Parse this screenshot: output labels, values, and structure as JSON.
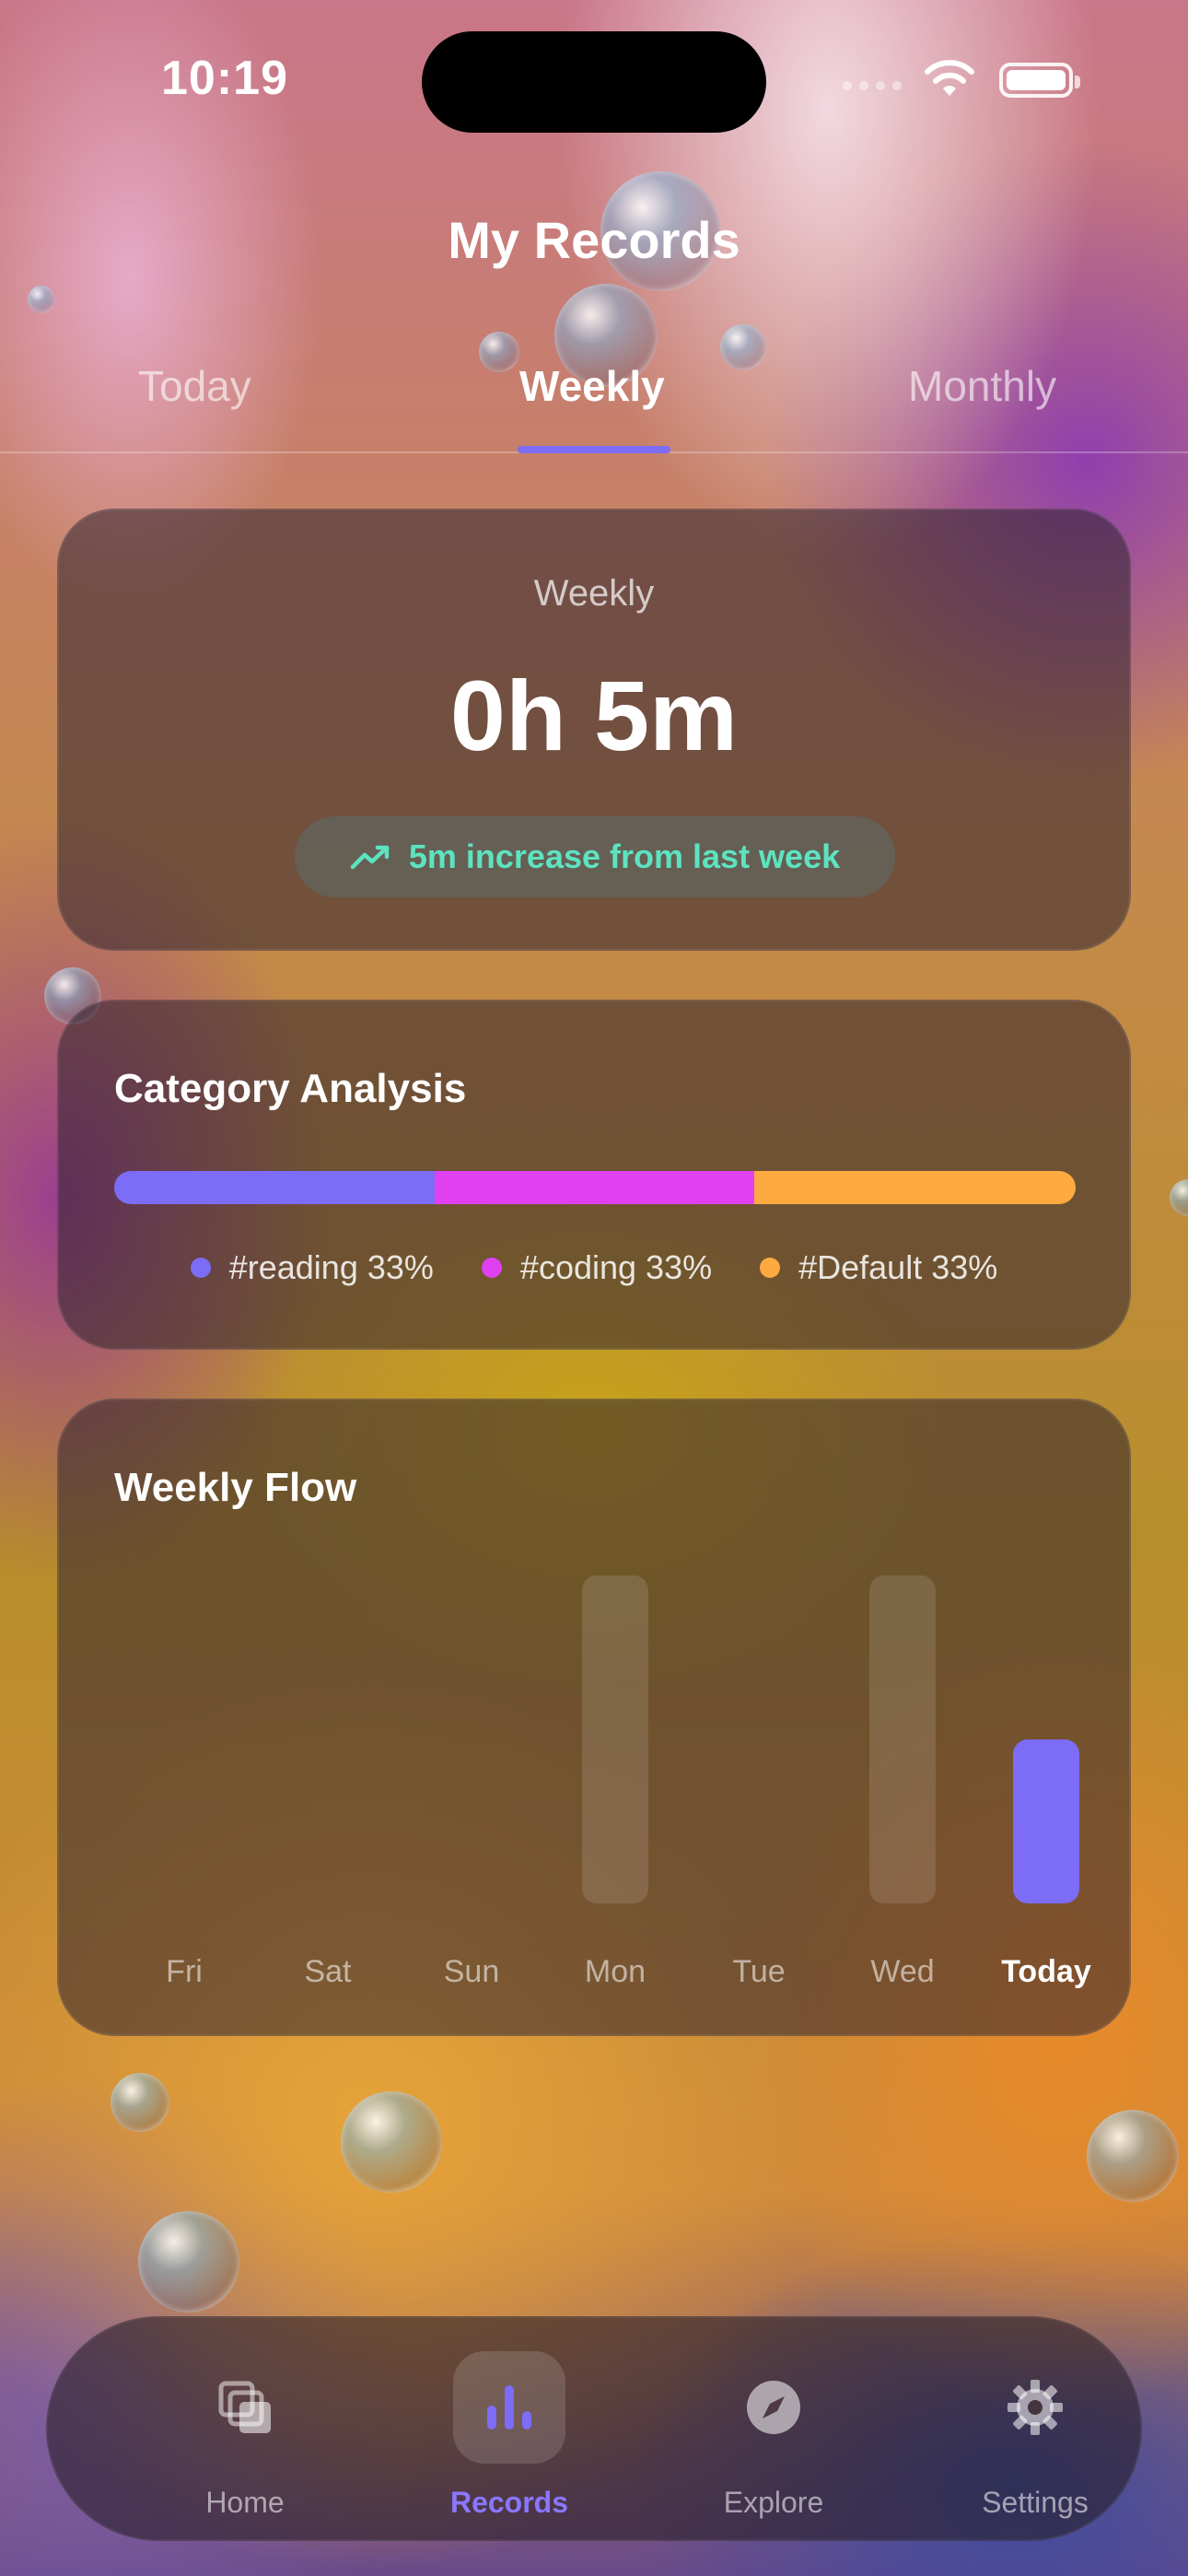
{
  "status": {
    "time": "10:19"
  },
  "header": {
    "title": "My Records"
  },
  "tabs": [
    {
      "label": "Today",
      "active": false
    },
    {
      "label": "Weekly",
      "active": true
    },
    {
      "label": "Monthly",
      "active": false
    }
  ],
  "summary": {
    "label": "Weekly",
    "value": "0h 5m",
    "trend_icon": "trending-up-icon",
    "trend_text": "5m increase from last week",
    "trend_color": "#5de3c0"
  },
  "category_analysis": {
    "title": "Category Analysis",
    "items": [
      {
        "name": "#reading",
        "percent_text": "33%",
        "share": 0.333,
        "color": "#7c6cf6"
      },
      {
        "name": "#coding",
        "percent_text": "33%",
        "share": 0.333,
        "color": "#e040f0"
      },
      {
        "name": "#Default",
        "percent_text": "33%",
        "share": 0.334,
        "color": "#ffaa40"
      }
    ]
  },
  "weekly_flow": {
    "title": "Weekly Flow",
    "chart_data": {
      "type": "bar",
      "categories": [
        "Fri",
        "Sat",
        "Sun",
        "Mon",
        "Tue",
        "Wed",
        "Today"
      ],
      "values": [
        0,
        0,
        0,
        1.0,
        0,
        1.0,
        0.5
      ],
      "highlight_index": 6,
      "bar_color": "#7c6cf6",
      "muted_color": "rgba(255,255,255,0.12)"
    }
  },
  "tabbar": {
    "items": [
      {
        "label": "Home",
        "icon": "cards-icon",
        "active": false
      },
      {
        "label": "Records",
        "icon": "bar-chart-icon",
        "active": true
      },
      {
        "label": "Explore",
        "icon": "compass-icon",
        "active": false
      },
      {
        "label": "Settings",
        "icon": "gear-icon",
        "active": false
      }
    ]
  },
  "colors": {
    "accent": "#7c6cf6"
  }
}
